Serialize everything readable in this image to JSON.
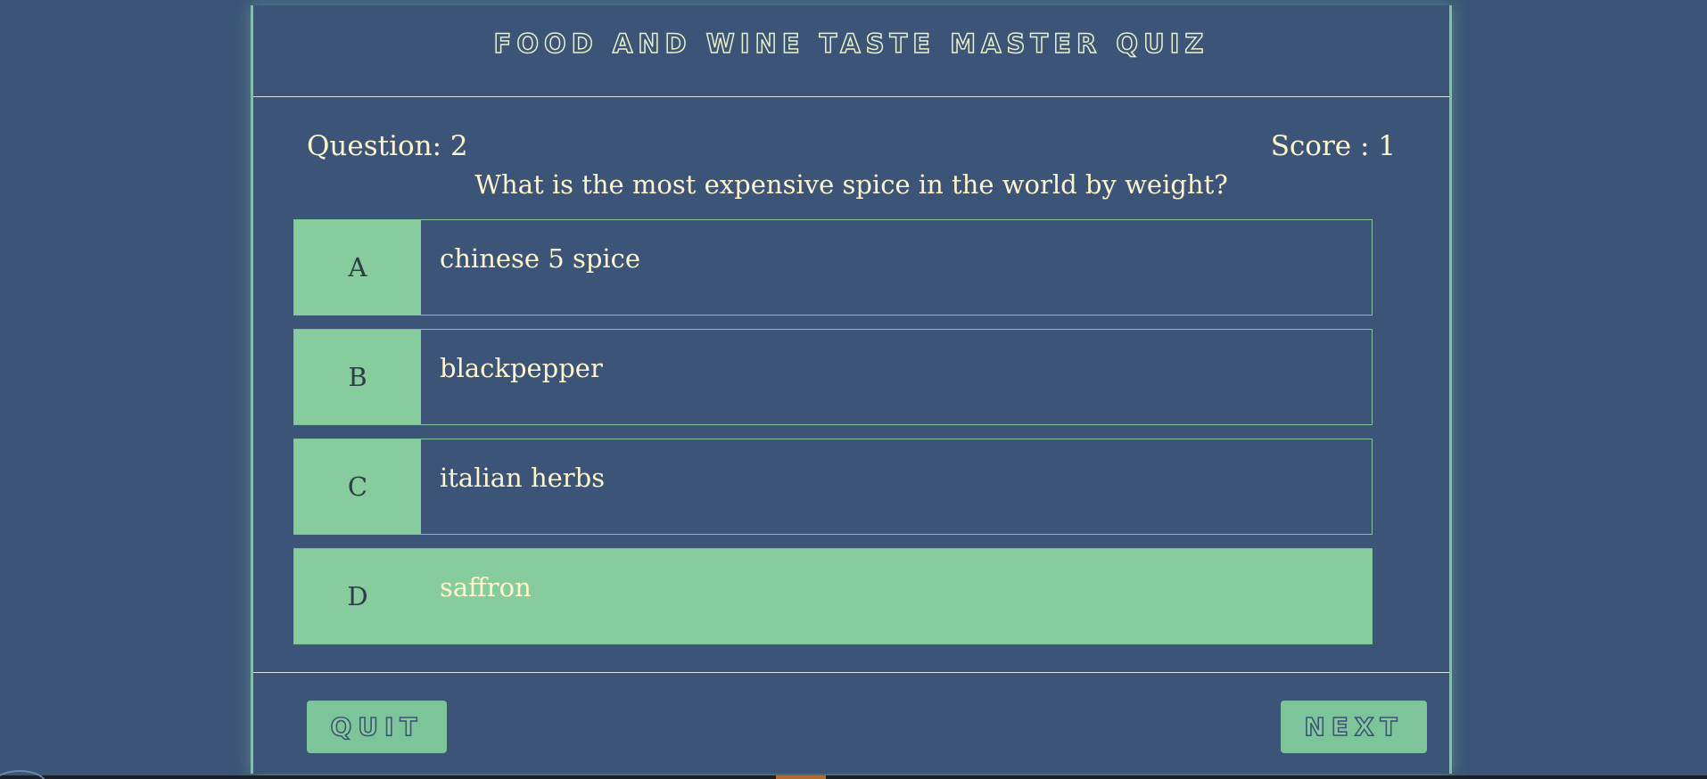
{
  "quiz": {
    "title": "Food and Wine Taste Master Quiz",
    "question_label": "Question: 2",
    "score_label": "Score : 1",
    "question_text": "What is the most expensive spice in the world by weight?"
  },
  "options": [
    {
      "letter": "A",
      "text": "chinese 5 spice",
      "selected": false
    },
    {
      "letter": "B",
      "text": "blackpepper",
      "selected": false
    },
    {
      "letter": "C",
      "text": "italian herbs",
      "selected": false
    },
    {
      "letter": "D",
      "text": "saffron",
      "selected": true
    }
  ],
  "buttons": {
    "quit_label": "QUIT",
    "next_label": "NEXT"
  },
  "colors": {
    "background": "#3b5478",
    "accent_green": "#86cc9c",
    "text_cream": "#fff5cc"
  }
}
